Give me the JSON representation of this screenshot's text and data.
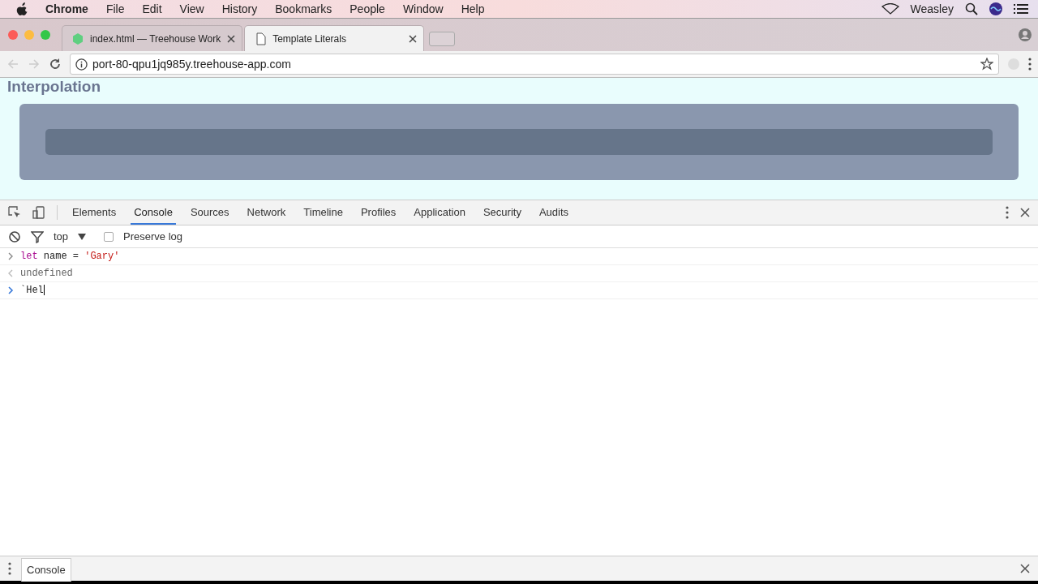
{
  "menubar": {
    "app": "Chrome",
    "items": [
      "File",
      "Edit",
      "View",
      "History",
      "Bookmarks",
      "People",
      "Window",
      "Help"
    ],
    "user": "Weasley"
  },
  "tabs": [
    {
      "title": "index.html — Treehouse Work",
      "selected": false,
      "kind": "workspace"
    },
    {
      "title": "Template Literals",
      "selected": true,
      "kind": "document"
    }
  ],
  "address": "port-80-qpu1jq985y.treehouse-app.com",
  "page": {
    "heading": "Interpolation"
  },
  "devtools": {
    "tabs": [
      {
        "label": "Elements",
        "selected": false
      },
      {
        "label": "Console",
        "selected": true
      },
      {
        "label": "Sources",
        "selected": false
      },
      {
        "label": "Network",
        "selected": false
      },
      {
        "label": "Timeline",
        "selected": false
      },
      {
        "label": "Profiles",
        "selected": false
      },
      {
        "label": "Application",
        "selected": false
      },
      {
        "label": "Security",
        "selected": false
      },
      {
        "label": "Audits",
        "selected": false
      }
    ],
    "context": "top",
    "preserve_log": {
      "label": "Preserve log",
      "checked": false
    },
    "lines": [
      {
        "kind": "input",
        "segments": [
          {
            "kind": "keyword",
            "text": "let"
          },
          {
            "kind": "plain",
            "text": " name = "
          },
          {
            "kind": "string",
            "text": "'Gary'"
          }
        ]
      },
      {
        "kind": "result",
        "segments": [
          {
            "kind": "muted",
            "text": "undefined"
          }
        ]
      },
      {
        "kind": "prompt",
        "segments": [
          {
            "kind": "plain",
            "text": "`Hel"
          }
        ]
      }
    ],
    "drawer_tab": "Console"
  }
}
